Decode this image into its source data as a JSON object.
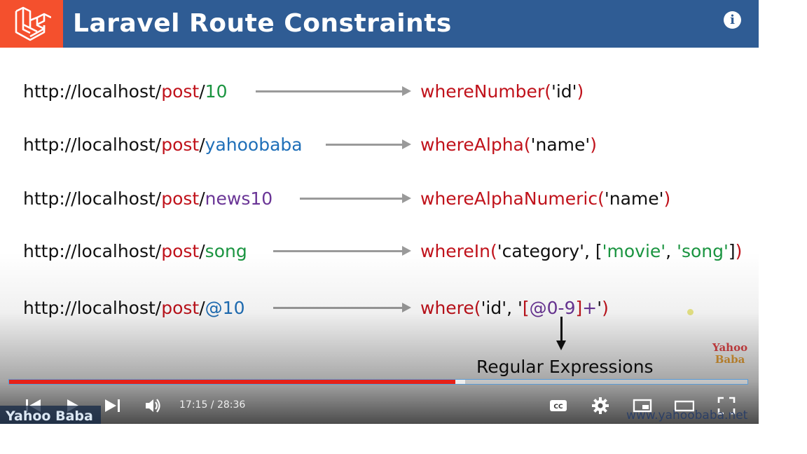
{
  "slide": {
    "title": "Laravel Route Constraints",
    "rows": [
      {
        "url_base": "http://localhost/",
        "url_post": "post",
        "url_sep": "/",
        "url_param": "10",
        "method_name": "whereNumber",
        "method_open": "(",
        "method_args": "'id'",
        "method_close": ")"
      },
      {
        "url_base": "http://localhost/",
        "url_post": "post",
        "url_sep": "/",
        "url_param": "yahoobaba",
        "method_name": "whereAlpha",
        "method_open": "(",
        "method_args": "'name'",
        "method_close": ")"
      },
      {
        "url_base": "http://localhost/",
        "url_post": "post",
        "url_sep": "/",
        "url_param": "news10",
        "method_name": "whereAlphaNumeric",
        "method_open": "(",
        "method_args": "'name'",
        "method_close": ")"
      },
      {
        "url_base": "http://localhost/",
        "url_post": "post",
        "url_sep": "/",
        "url_param": "song",
        "method_name": "whereIn",
        "method_open": "(",
        "in_a": "'category', [",
        "in_b": "'movie'",
        "in_c": ", ",
        "in_d": "'song'",
        "in_e": "]",
        "method_close": ")"
      },
      {
        "url_base": "http://localhost/",
        "url_post": "post",
        "url_sep": "/",
        "url_param": "@10",
        "method_name": "where",
        "method_open": "(",
        "w_a": "'id', '",
        "w_b": "[",
        "w_c": "@0-9",
        "w_d": "]",
        "w_e": "+",
        "w_f": "'",
        "method_close": ")"
      }
    ],
    "regex_label": "Regular Expressions",
    "brand_logo_line1": "Yahoo",
    "brand_logo_line2": "Baba"
  },
  "player": {
    "time_display": "17:15 / 28:36",
    "progress_played": 0.6042,
    "progress_buffered": 0.618,
    "played_color": "#e62117",
    "watermark_left": "Yahoo Baba",
    "watermark_right": "www.yahoobaba.net",
    "info_symbol": "i",
    "cc_symbol": "CC"
  },
  "colors": {
    "title_bar": "#2f5c94",
    "logo_bg": "#f4502d",
    "keyword_red": "#c0121b",
    "green": "#1a9440",
    "blue": "#1f6fb8",
    "purple": "#6a3596"
  },
  "icons": [
    "laravel-logo-icon",
    "info-icon",
    "prev-icon",
    "play-icon",
    "next-icon",
    "volume-icon",
    "closed-captions-icon",
    "settings-icon",
    "miniplayer-icon",
    "theater-mode-icon",
    "fullscreen-icon"
  ]
}
